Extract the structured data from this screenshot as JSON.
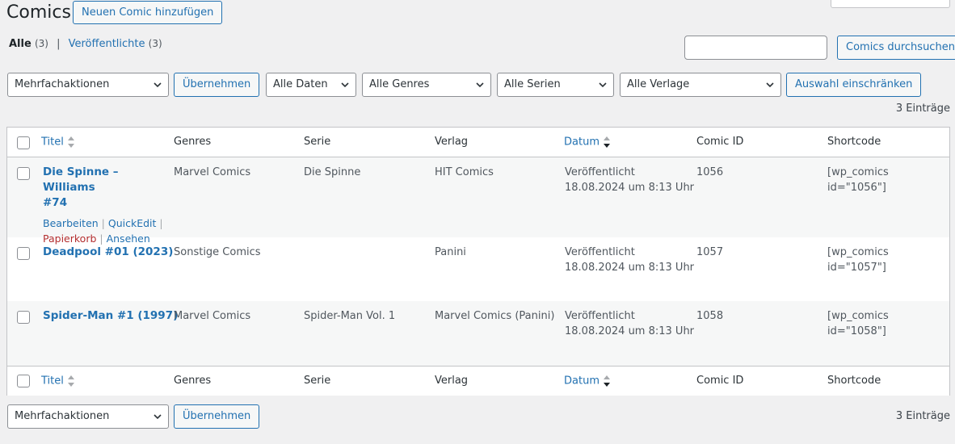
{
  "header": {
    "title": "Comics",
    "add_new": "Neuen Comic hinzufügen"
  },
  "views": {
    "all_label": "Alle",
    "all_count": "(3)",
    "separator": "|",
    "published_label": "Veröffentlichte",
    "published_count": "(3)"
  },
  "search": {
    "value": "",
    "button": "Comics durchsuchen"
  },
  "filters": {
    "bulk_actions": "Mehrfachaktionen",
    "apply": "Übernehmen",
    "dates": "Alle Daten",
    "genres": "Alle Genres",
    "series": "Alle Serien",
    "publishers": "Alle Verlage",
    "filter_button": "Auswahl einschränken"
  },
  "items_count": "3 Einträge",
  "columns": {
    "title": "Titel",
    "genres": "Genres",
    "series": "Serie",
    "publisher": "Verlag",
    "date": "Datum",
    "comic_id": "Comic ID",
    "shortcode": "Shortcode"
  },
  "rows": [
    {
      "title_line1": "Die Spinne – Williams",
      "title_line2": "#74",
      "genre": "Marvel Comics",
      "series": "Die Spinne",
      "publisher": "HIT Comics",
      "status": "Veröffentlicht",
      "date": "18.08.2024 um 8:13 Uhr",
      "comic_id": "1056",
      "shortcode": "[wp_comics id=\"1056\"]",
      "actions": {
        "edit": "Bearbeiten",
        "quickedit": "QuickEdit",
        "trash": "Papierkorb",
        "view": "Ansehen",
        "sep": "|"
      }
    },
    {
      "title_line1": "Deadpool #01 (2023)",
      "genre": "Sonstige Comics",
      "series": "",
      "publisher": "Panini",
      "status": "Veröffentlicht",
      "date": "18.08.2024 um 8:13 Uhr",
      "comic_id": "1057",
      "shortcode": "[wp_comics id=\"1057\"]"
    },
    {
      "title_line1": "Spider-Man #1 (1997)",
      "genre": "Marvel Comics",
      "series": "Spider-Man Vol. 1",
      "publisher": "Marvel Comics (Panini)",
      "status": "Veröffentlicht",
      "date": "18.08.2024 um 8:13 Uhr",
      "comic_id": "1058",
      "shortcode": "[wp_comics id=\"1058\"]"
    }
  ],
  "colors": {
    "accent": "#2271b1",
    "trash": "#b32d2e",
    "background": "#f0f0f1"
  }
}
